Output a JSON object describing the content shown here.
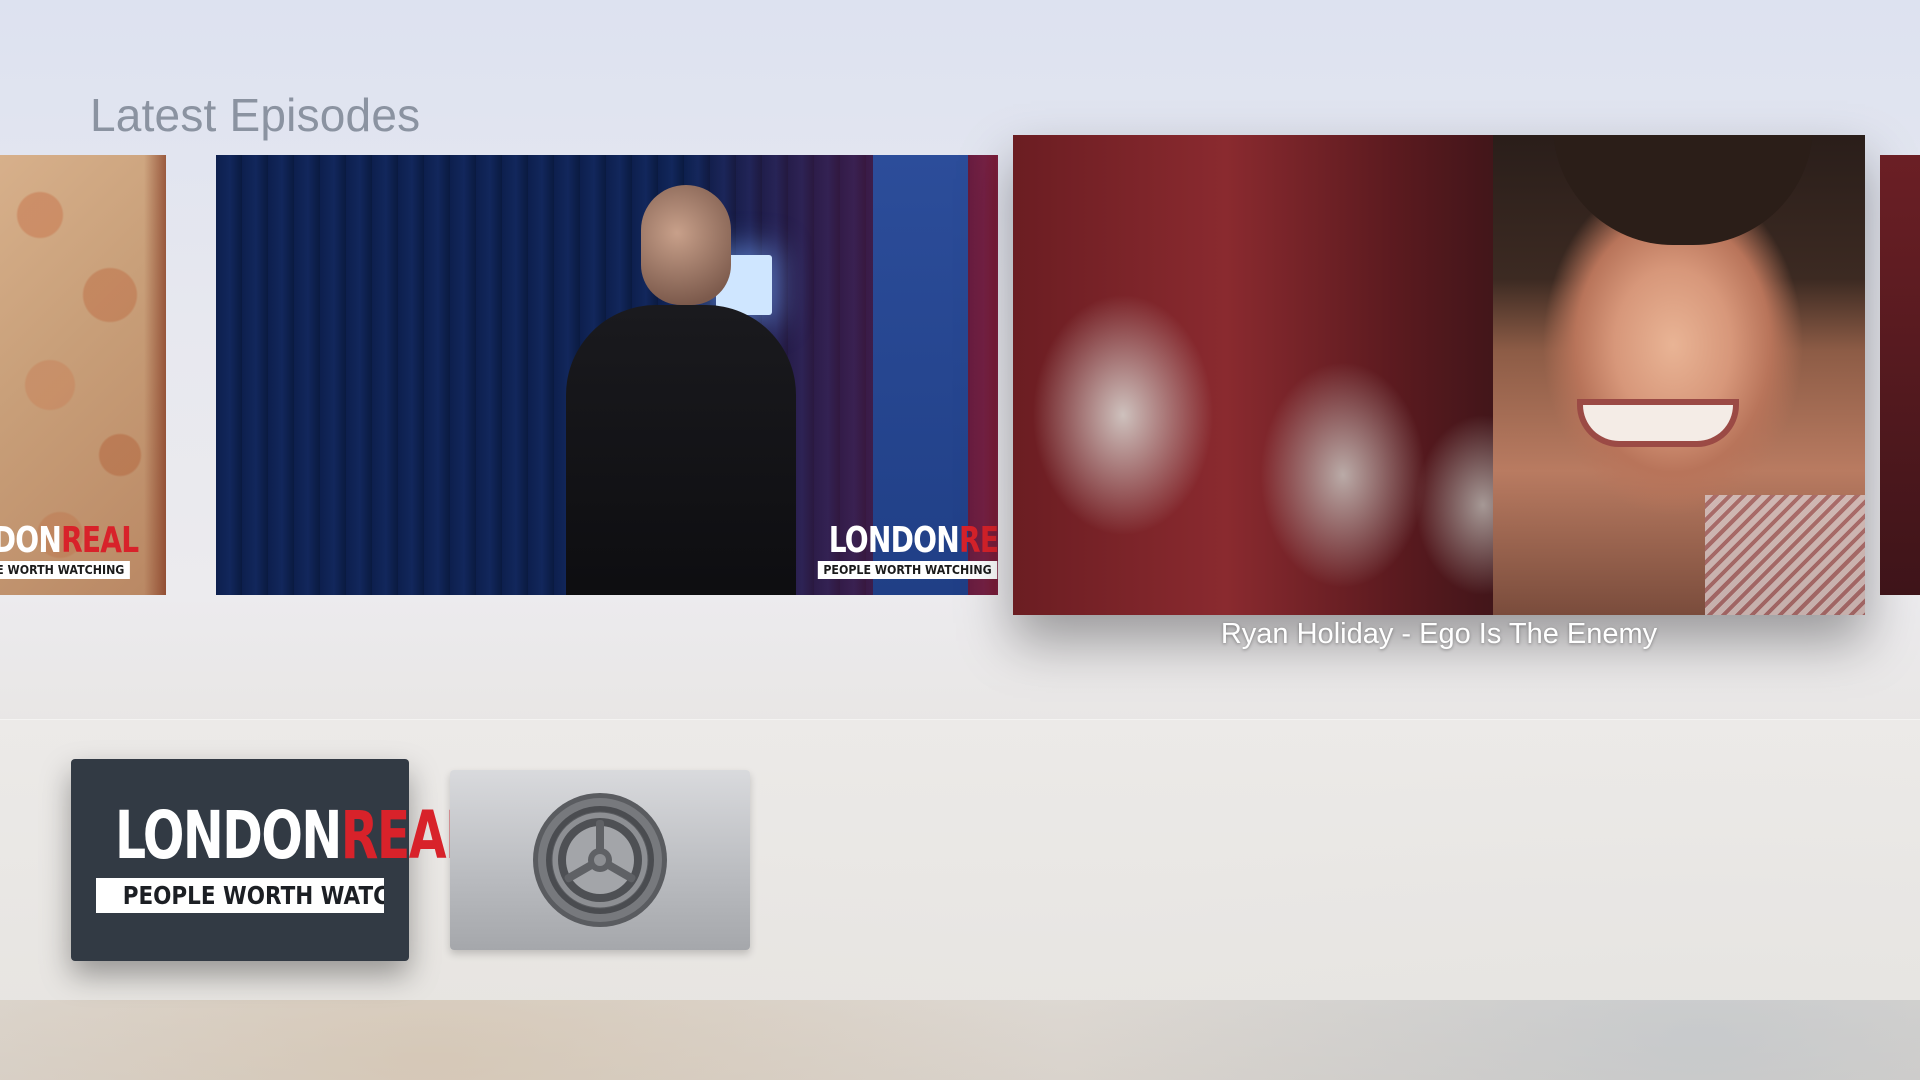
{
  "shelf": {
    "title": "Latest Episodes",
    "focused_episode_title": "Ryan Holiday - Ego Is The Enemy",
    "watermark": {
      "name_part1": "LONDON",
      "name_part2": "REAL",
      "tagline": "PEOPLE WORTH WATCHING"
    },
    "left_watermark": {
      "name_part1": "NDON",
      "name_part2": "REAL",
      "tagline": "OPLE WORTH WATCHING"
    }
  },
  "dock": {
    "apps": [
      {
        "name_part1": "LONDON",
        "name_part2": "REAL",
        "tagline": "PEOPLE WORTH WATCHING",
        "icon": "london-real-logo"
      },
      {
        "icon": "gear-icon"
      }
    ]
  },
  "colors": {
    "brand_red": "#d8222a",
    "app_tile_bg": "#323a44",
    "title_gray": "#8b93a1"
  }
}
